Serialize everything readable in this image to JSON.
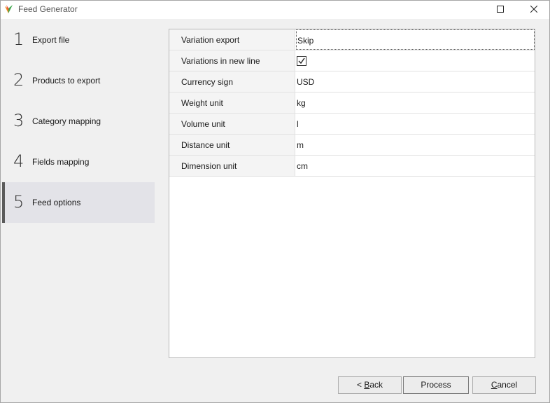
{
  "window": {
    "title": "Feed Generator"
  },
  "sidebar": {
    "steps": [
      {
        "num": "1",
        "label": "Export file"
      },
      {
        "num": "2",
        "label": "Products to export"
      },
      {
        "num": "3",
        "label": "Category mapping"
      },
      {
        "num": "4",
        "label": "Fields mapping"
      },
      {
        "num": "5",
        "label": "Feed options"
      }
    ],
    "active_step": "5"
  },
  "options": [
    {
      "name": "Variation export",
      "value": "Skip"
    },
    {
      "name": "Variations in new line",
      "value": "",
      "checked": true
    },
    {
      "name": "Currency sign",
      "value": "USD"
    },
    {
      "name": "Weight unit",
      "value": "kg"
    },
    {
      "name": "Volume unit",
      "value": "l"
    },
    {
      "name": "Distance unit",
      "value": "m"
    },
    {
      "name": "Dimension unit",
      "value": "cm"
    }
  ],
  "buttons": {
    "back_prefix": "< ",
    "back_mnemonic": "B",
    "back_rest": "ack",
    "process": "Process",
    "cancel_mnemonic": "C",
    "cancel_rest": "ancel"
  },
  "colors": {
    "accent_bar": "#5a5a5a",
    "app_icon_orange": "#f28a22",
    "app_icon_green": "#3aa64a"
  }
}
